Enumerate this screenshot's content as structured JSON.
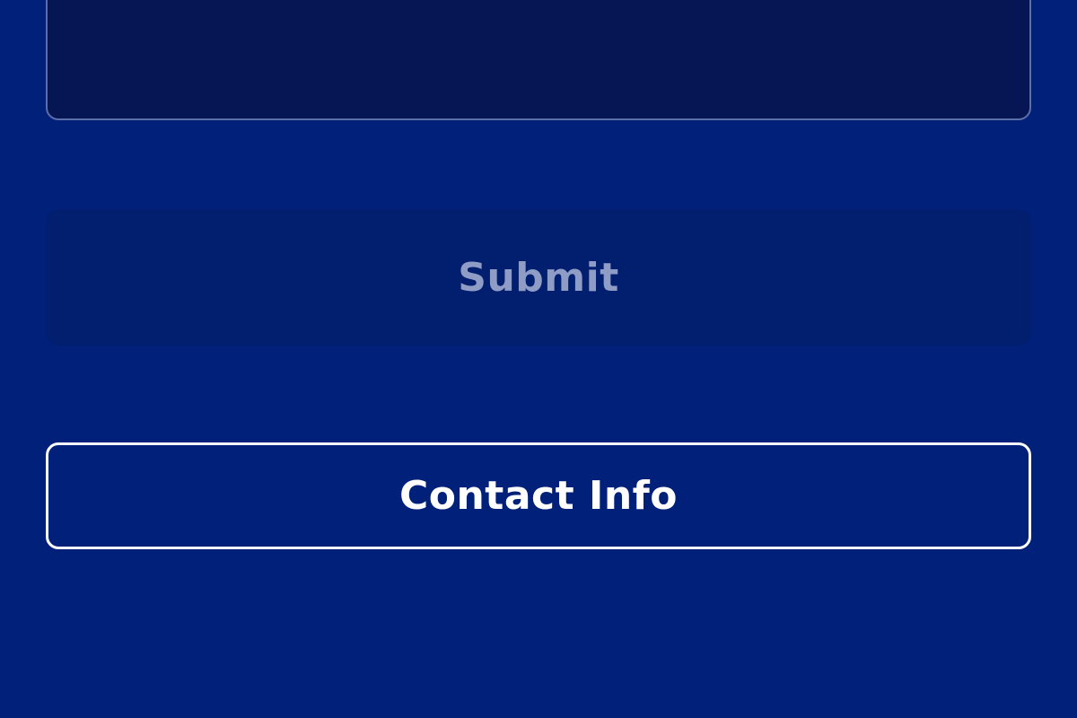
{
  "form": {
    "message_field": {
      "value": "",
      "placeholder": ""
    },
    "submit_label": "Submit",
    "contact_label": "Contact Info"
  },
  "colors": {
    "background": "#00207a",
    "field_background": "#061553",
    "field_border": "#5c6ea8",
    "submit_disabled_background": "#021e6e",
    "submit_disabled_text": "#8f9dc6",
    "contact_border": "#ffffff",
    "contact_text": "#ffffff"
  }
}
